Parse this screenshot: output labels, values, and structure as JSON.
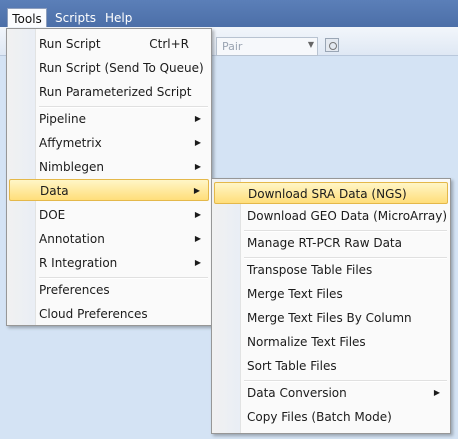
{
  "menubar": {
    "tools": "Tools",
    "scripts": "Scripts",
    "help": "Help"
  },
  "toolbar": {
    "combo_value": "Pair"
  },
  "tools_menu": {
    "run_script": "Run Script",
    "run_script_shortcut": "Ctrl+R",
    "run_script_queue": "Run Script (Send To Queue)",
    "run_parameterized": "Run Parameterized Script",
    "pipeline": "Pipeline",
    "affymetrix": "Affymetrix",
    "nimblegen": "Nimblegen",
    "data": "Data",
    "doe": "DOE",
    "annotation": "Annotation",
    "r_integration": "R Integration",
    "preferences": "Preferences",
    "cloud_preferences": "Cloud Preferences"
  },
  "data_menu": {
    "download_sra": "Download SRA Data (NGS)",
    "download_geo": "Download GEO Data (MicroArray)",
    "manage_rtpcr": "Manage RT-PCR Raw Data",
    "transpose": "Transpose Table Files",
    "merge_text": "Merge Text Files",
    "merge_by_column": "Merge Text Files By Column",
    "normalize": "Normalize Text Files",
    "sort_table": "Sort Table Files",
    "data_conversion": "Data Conversion",
    "copy_files": "Copy Files (Batch Mode)"
  },
  "colors": {
    "menubar": "#4f73ab",
    "highlight": "#ffe48a",
    "background": "#d4e3f4"
  }
}
